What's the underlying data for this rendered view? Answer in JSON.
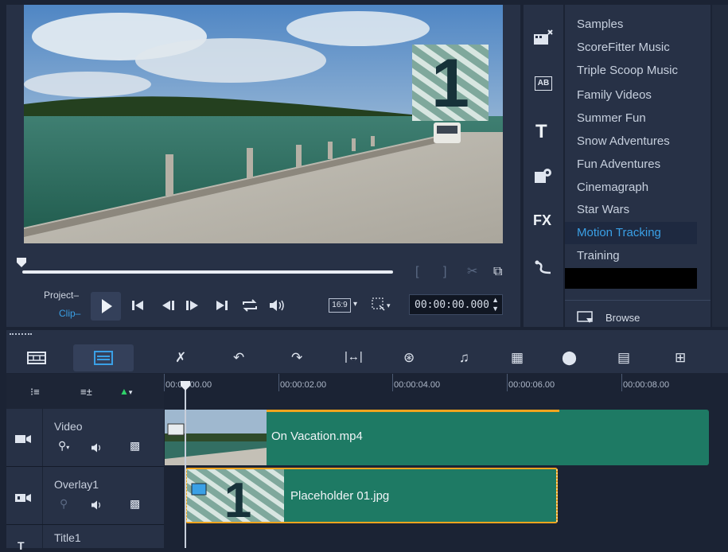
{
  "preview": {
    "project_label": "Project–",
    "clip_label": "Clip–",
    "aspect_ratio": "16:9",
    "timecode": "00:00:00.000",
    "overlay_number": "1"
  },
  "library": {
    "items": [
      {
        "label": "Samples"
      },
      {
        "label": "ScoreFitter Music"
      },
      {
        "label": "Triple Scoop Music"
      },
      {
        "label": "Family Videos"
      },
      {
        "label": "Summer Fun"
      },
      {
        "label": "Snow Adventures"
      },
      {
        "label": "Fun Adventures"
      },
      {
        "label": "Cinemagraph"
      },
      {
        "label": "Star Wars"
      },
      {
        "label": "Motion Tracking"
      },
      {
        "label": "Training"
      }
    ],
    "selected": "Motion Tracking",
    "browse_label": "Browse"
  },
  "tool_strip": {
    "fx_label": "FX",
    "text_label": "T",
    "ab_label": "AB"
  },
  "timeline": {
    "ruler": [
      "00:00:00.00",
      "00:00:02.00",
      "00:00:04.00",
      "00:00:06.00",
      "00:00:08.00"
    ],
    "tracks": [
      {
        "name": "Video"
      },
      {
        "name": "Overlay1"
      },
      {
        "name": "Title1"
      }
    ],
    "clips": {
      "video": "On Vacation.mp4",
      "overlay": "Placeholder 01.jpg",
      "overlay_number": "1"
    }
  },
  "colors": {
    "accent": "#3aa0e6",
    "clip_green": "#1e7a64",
    "overlay_border": "#f0a41e"
  }
}
